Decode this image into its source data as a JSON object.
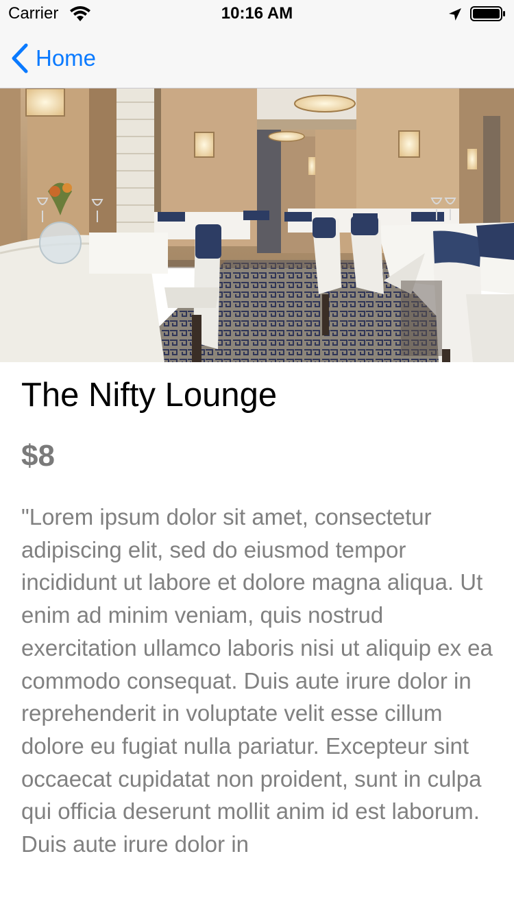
{
  "status_bar": {
    "carrier": "Carrier",
    "time": "10:16 AM",
    "icons": [
      "wifi-icon",
      "location-arrow-icon",
      "battery-icon"
    ]
  },
  "nav": {
    "back_label": "Home",
    "back_icon": "chevron-left-icon",
    "accent_color": "#0a7aff"
  },
  "hero": {
    "image_subject": "restaurant dining room interior"
  },
  "listing": {
    "title": "The Nifty Lounge",
    "price": "$8",
    "description": "\"Lorem ipsum dolor sit amet, consectetur adipiscing elit, sed do eiusmod tempor incididunt ut labore et dolore magna aliqua. Ut enim ad minim veniam, quis nostrud exercitation ullamco laboris nisi ut aliquip ex ea commodo consequat. Duis aute irure dolor in reprehenderit in voluptate velit esse cillum dolore eu fugiat nulla pariatur. Excepteur sint occaecat cupidatat non proident, sunt in culpa qui officia deserunt mollit anim id est laborum. Duis aute irure dolor in"
  }
}
